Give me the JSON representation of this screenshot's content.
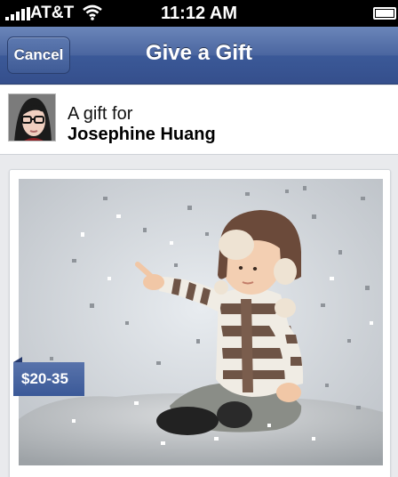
{
  "status_bar": {
    "carrier": "AT&T",
    "time": "11:12 AM",
    "signal_bars": 5,
    "battery_level": 0.9,
    "icons": [
      "signal-icon",
      "wifi-icon",
      "battery-icon"
    ]
  },
  "nav_bar": {
    "cancel_label": "Cancel",
    "title": "Give a Gift",
    "color": "#3b5998"
  },
  "recipient": {
    "prefix": "A gift for",
    "name": "Josephine Huang"
  },
  "gift": {
    "price_range": "$20-35",
    "image": "photo of a toddler in a striped sweater and aviator hat sitting among confetti"
  },
  "colors": {
    "brand_blue": "#3b5998",
    "background": "#e9eaed"
  }
}
